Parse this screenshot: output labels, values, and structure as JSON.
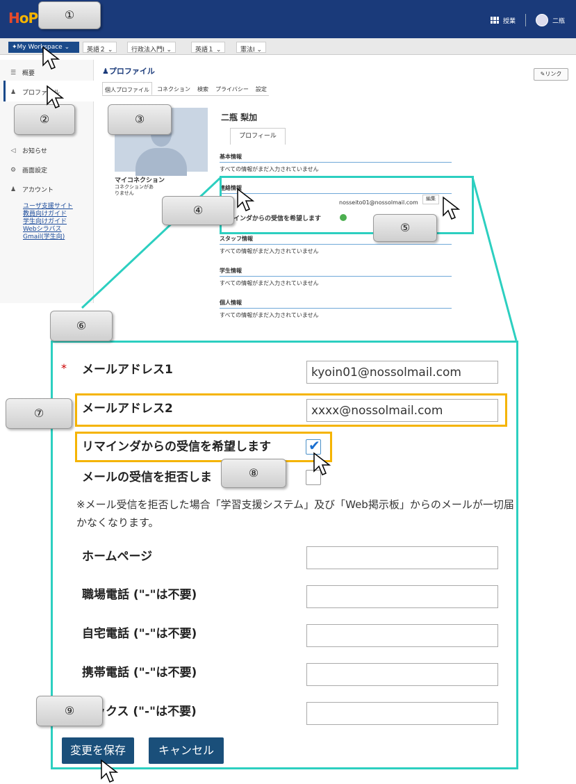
{
  "header": {
    "logo_main": "H",
    "logo_rest": "oP",
    "classes_label": "授業",
    "user_name": "二瓶"
  },
  "sitebar": {
    "workspace_label": "My Workspace",
    "tabs": [
      "英語２",
      "行政法入門Ⅰ",
      "英語１",
      "憲法Ⅰ"
    ]
  },
  "leftnav": {
    "overview": "概要",
    "profile": "プロファイル",
    "notice": "お知らせ",
    "screen_settings": "画面設定",
    "account": "アカウント",
    "links": [
      "ユーザ支援サイト",
      "教員向けガイド",
      "学生向けガイド",
      "Webシラバス",
      "Gmail(学生向)"
    ]
  },
  "profile": {
    "title": "プロファイル",
    "link_btn": "✎リンク",
    "subtabs": [
      "個人プロファイル",
      "コネクション",
      "検索",
      "プライバシー",
      "設定"
    ],
    "name": "二瓶 梨加",
    "profile_tab": "プロフィール",
    "my_connection": "マイコネクション",
    "connection_note": "コネクションがありません",
    "sections": [
      {
        "heading": "基本情報",
        "text": "すべての情報がまだ入力されていません"
      },
      {
        "heading": "連絡情報",
        "text": ""
      },
      {
        "heading": "スタッフ情報",
        "text": "すべての情報がまだ入力されていません"
      },
      {
        "heading": "学生情報",
        "text": "すべての情報がまだ入力されていません"
      },
      {
        "heading": "個人情報",
        "text": "すべての情報がまだ入力されていません"
      }
    ],
    "email_small": "nosseito01@nossolmail.com",
    "edit_small": "編集",
    "remind_small": "リマインダからの受信を希望します"
  },
  "form": {
    "email1_label": "メールアドレス1",
    "email1_value": "kyoin01@nossolmail.com",
    "email2_label": "メールアドレス2",
    "email2_value": "xxxx@nossolmail.com",
    "remind_label": "リマインダからの受信を希望します",
    "reject_label": "メールの受信を拒否しま",
    "note": "※メール受信を拒否した場合「学習支援システム」及び「Web掲示板」からのメールが一切届かなくなります。",
    "homepage_label": "ホームページ",
    "work_phone_label": "職場電話 (\"-\"は不要)",
    "home_phone_label": "自宅電話 (\"-\"は不要)",
    "mobile_label": "携帯電話 (\"-\"は不要)",
    "fax_label": "ァックス (\"-\"は不要)",
    "save_btn": "変更を保存",
    "cancel_btn": "キャンセル"
  },
  "callouts": [
    "①",
    "②",
    "③",
    "④",
    "⑤",
    "⑥",
    "⑦",
    "⑧",
    "⑨"
  ],
  "colors": {
    "highlight_cyan": "#2ccfc0",
    "highlight_orange": "#f5b400",
    "topbar": "#1a3a7a",
    "button": "#1a4f7a"
  }
}
